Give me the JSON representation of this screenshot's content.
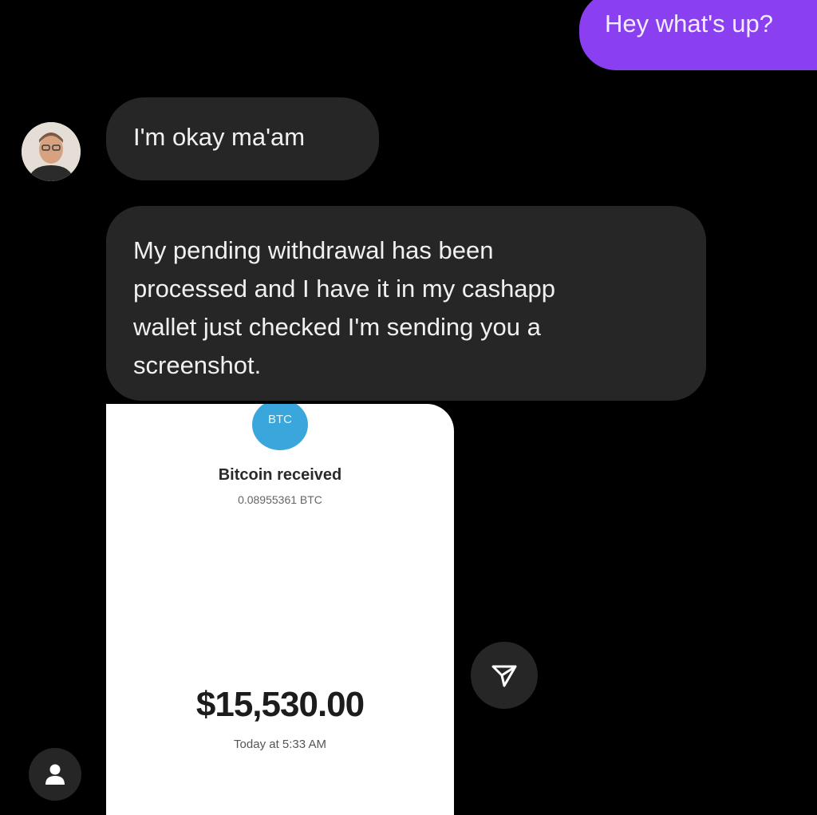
{
  "conversation": {
    "sent_message": "Hey what's up?",
    "received_messages": [
      {
        "text": "I'm okay ma'am"
      },
      {
        "lines": [
          "My pending withdrawal has been",
          "processed and I have it in my cashapp",
          "wallet just checked I'm sending you a",
          "screenshot."
        ]
      }
    ],
    "avatar_icon": "contact-avatar",
    "theme": {
      "background": "#000000",
      "sent_bubble": "#8a3ff0",
      "received_bubble": "#262626"
    }
  },
  "attachment": {
    "badge": "BTC",
    "title": "Bitcoin received",
    "crypto_amount": "0.08955361 BTC",
    "usd_amount": "$15,530.00",
    "timestamp": "Today at 5:33 AM",
    "badge_color": "#3aa7dc"
  },
  "controls": {
    "share_icon": "share-paper-plane-icon",
    "profile_icon": "person-icon"
  }
}
